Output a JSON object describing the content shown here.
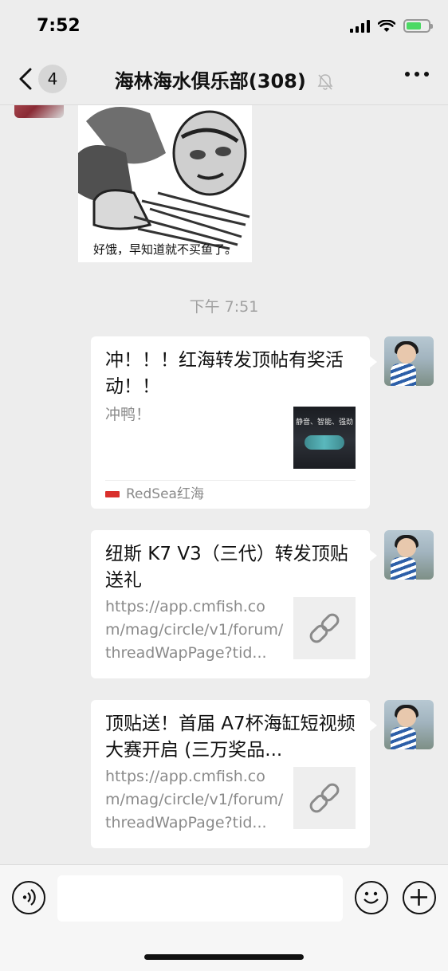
{
  "status": {
    "time": "7:52"
  },
  "nav": {
    "back_badge": "4",
    "title": "海林海水俱乐部(308)"
  },
  "sticker": {
    "caption": "好饿，早知道就不买鱼了。"
  },
  "time_separator": "下午 7:51",
  "messages": [
    {
      "title": "冲！！！红海转发顶帖有奖活动！！",
      "desc": "冲鸭！",
      "thumb_text": "静音、智能、强劲",
      "source": "RedSea红海"
    },
    {
      "title": "纽斯 K7 V3（三代）转发顶贴送礼",
      "desc": "https://app.cmfish.com/mag/circle/v1/forum/threadWapPage?tid..."
    },
    {
      "title": "顶贴送！首届 A7杯海缸短视频大赛开启 (三万奖品...",
      "desc": "https://app.cmfish.com/mag/circle/v1/forum/threadWapPage?tid..."
    }
  ]
}
